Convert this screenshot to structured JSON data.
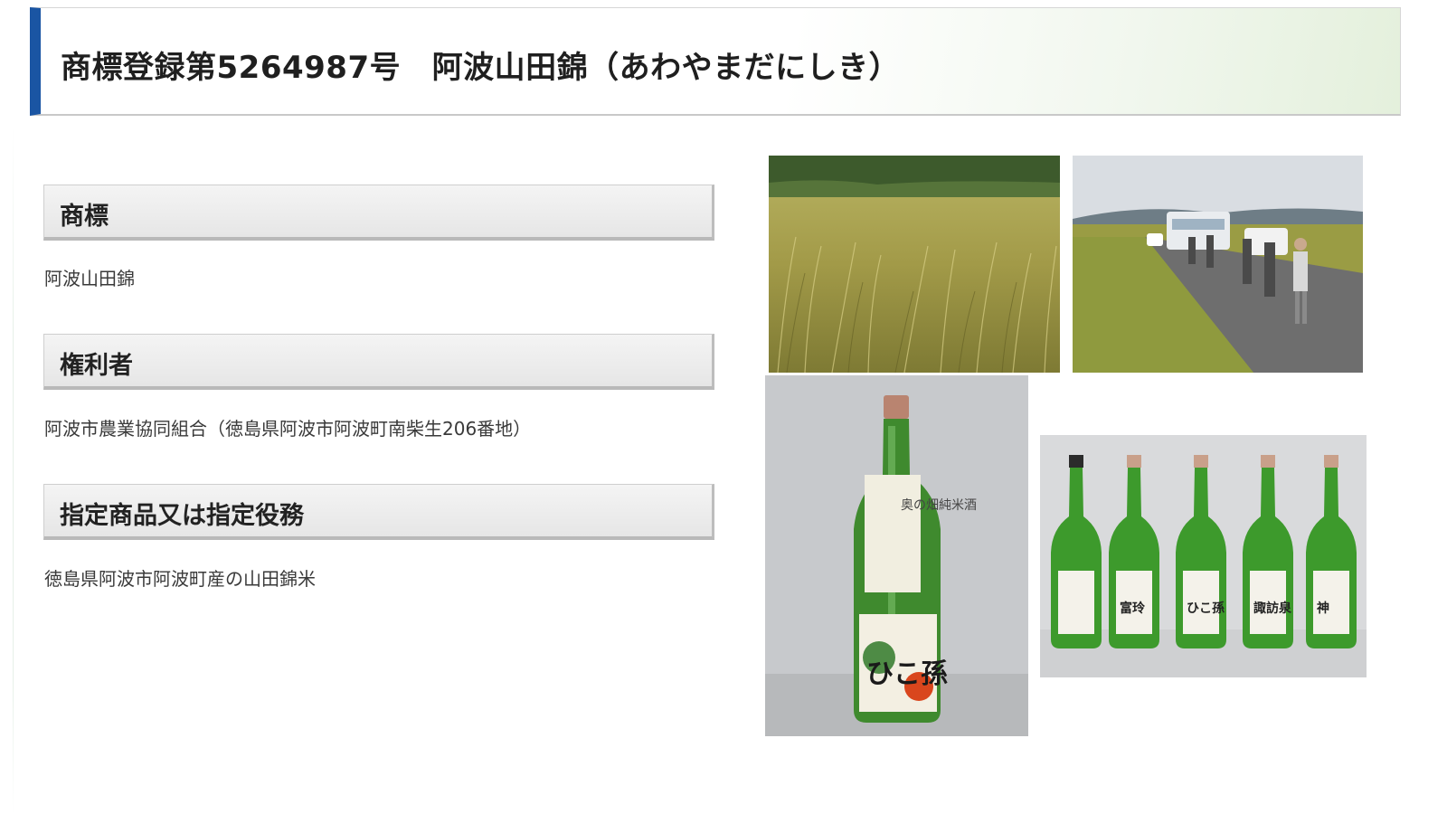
{
  "title": "商標登録第5264987号　阿波山田錦（あわやまだにしき）",
  "sections": [
    {
      "heading": "商標",
      "body": "阿波山田錦"
    },
    {
      "heading": "権利者",
      "body": "阿波市農業協同組合（徳島県阿波市阿波町南柴生206番地）"
    },
    {
      "heading": "指定商品又は指定役務",
      "body": "徳島県阿波市阿波町産の山田錦米"
    }
  ],
  "photos": {
    "bottle_single": {
      "label_main": "ひこ孫",
      "neck_tag": "奥の畑純米酒"
    },
    "bottle_row": {
      "labels": [
        "",
        "富玲",
        "ひこ孫",
        "諏訪泉",
        "神"
      ]
    }
  },
  "colors": {
    "accent_bar": "#1a55a3",
    "heading_bg": "#e9e9e9",
    "title_gradient_end": "#e4f0dc"
  }
}
